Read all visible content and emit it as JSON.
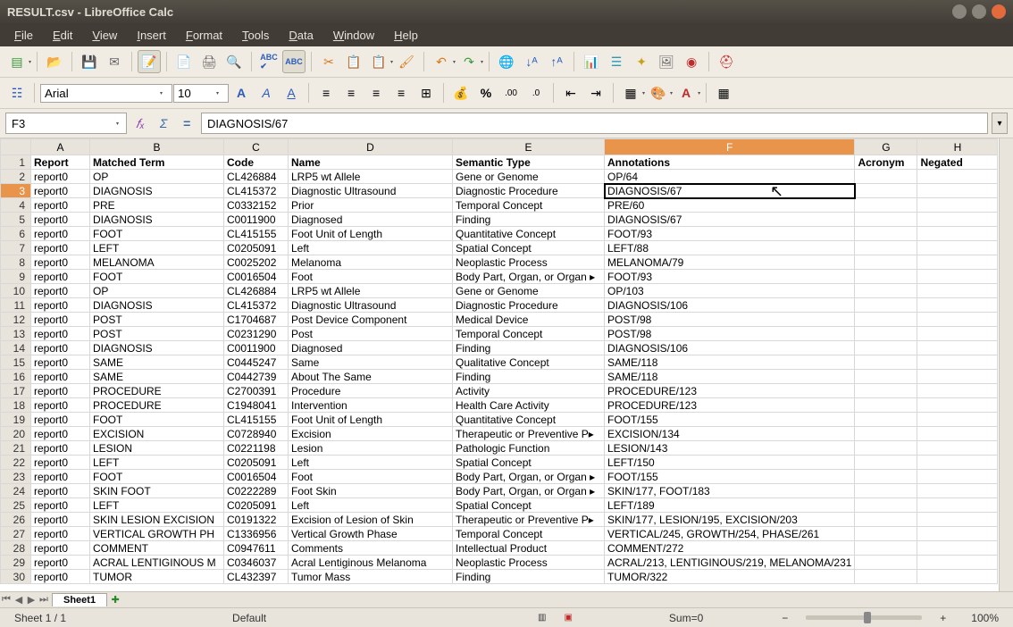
{
  "window": {
    "title": "RESULT.csv - LibreOffice Calc"
  },
  "menu": {
    "items": [
      "File",
      "Edit",
      "View",
      "Insert",
      "Format",
      "Tools",
      "Data",
      "Window",
      "Help"
    ]
  },
  "toolbar2": {
    "font_name": "Arial",
    "font_size": "10"
  },
  "formula": {
    "cell_ref": "F3",
    "content": "DIAGNOSIS/67"
  },
  "columns": [
    "A",
    "B",
    "C",
    "D",
    "E",
    "F",
    "G",
    "H"
  ],
  "selected_col": "F",
  "selected_row": 3,
  "active_cell": "F3",
  "rows": [
    {
      "n": 1,
      "A": "Report",
      "B": "Matched Term",
      "C": "Code",
      "D": "Name",
      "E": "Semantic Type",
      "F": "Annotations",
      "G": "Acronym",
      "H": "Negated"
    },
    {
      "n": 2,
      "A": "report0",
      "B": "OP",
      "C": "CL426884",
      "D": "LRP5 wt Allele",
      "E": "Gene or Genome",
      "F": "OP/64",
      "G": "",
      "H": ""
    },
    {
      "n": 3,
      "A": "report0",
      "B": "DIAGNOSIS",
      "C": "CL415372",
      "D": "Diagnostic Ultrasound",
      "E": "Diagnostic Procedure",
      "F": "DIAGNOSIS/67",
      "G": "",
      "H": ""
    },
    {
      "n": 4,
      "A": "report0",
      "B": "PRE",
      "C": "C0332152",
      "D": "Prior",
      "E": "Temporal Concept",
      "F": "PRE/60",
      "G": "",
      "H": ""
    },
    {
      "n": 5,
      "A": "report0",
      "B": "DIAGNOSIS",
      "C": "C0011900",
      "D": "Diagnosed",
      "E": "Finding",
      "F": "DIAGNOSIS/67",
      "G": "",
      "H": ""
    },
    {
      "n": 6,
      "A": "report0",
      "B": "FOOT",
      "C": "CL415155",
      "D": "Foot Unit of Length",
      "E": "Quantitative Concept",
      "F": "FOOT/93",
      "G": "",
      "H": ""
    },
    {
      "n": 7,
      "A": "report0",
      "B": "LEFT",
      "C": "C0205091",
      "D": "Left",
      "E": "Spatial Concept",
      "F": "LEFT/88",
      "G": "",
      "H": ""
    },
    {
      "n": 8,
      "A": "report0",
      "B": "MELANOMA",
      "C": "C0025202",
      "D": "Melanoma",
      "E": "Neoplastic Process",
      "F": "MELANOMA/79",
      "G": "",
      "H": ""
    },
    {
      "n": 9,
      "A": "report0",
      "B": "FOOT",
      "C": "C0016504",
      "D": "Foot",
      "E": "Body Part, Organ, or Organ ▸",
      "F": "FOOT/93",
      "G": "",
      "H": ""
    },
    {
      "n": 10,
      "A": "report0",
      "B": "OP",
      "C": "CL426884",
      "D": "LRP5 wt Allele",
      "E": "Gene or Genome",
      "F": "OP/103",
      "G": "",
      "H": ""
    },
    {
      "n": 11,
      "A": "report0",
      "B": "DIAGNOSIS",
      "C": "CL415372",
      "D": "Diagnostic Ultrasound",
      "E": "Diagnostic Procedure",
      "F": "DIAGNOSIS/106",
      "G": "",
      "H": ""
    },
    {
      "n": 12,
      "A": "report0",
      "B": "POST",
      "C": "C1704687",
      "D": "Post Device Component",
      "E": "Medical Device",
      "F": "POST/98",
      "G": "",
      "H": ""
    },
    {
      "n": 13,
      "A": "report0",
      "B": "POST",
      "C": "C0231290",
      "D": "Post",
      "E": "Temporal Concept",
      "F": "POST/98",
      "G": "",
      "H": ""
    },
    {
      "n": 14,
      "A": "report0",
      "B": "DIAGNOSIS",
      "C": "C0011900",
      "D": "Diagnosed",
      "E": "Finding",
      "F": "DIAGNOSIS/106",
      "G": "",
      "H": ""
    },
    {
      "n": 15,
      "A": "report0",
      "B": "SAME",
      "C": "C0445247",
      "D": "Same",
      "E": "Qualitative Concept",
      "F": "SAME/118",
      "G": "",
      "H": ""
    },
    {
      "n": 16,
      "A": "report0",
      "B": "SAME",
      "C": "C0442739",
      "D": "About The Same",
      "E": "Finding",
      "F": "SAME/118",
      "G": "",
      "H": ""
    },
    {
      "n": 17,
      "A": "report0",
      "B": "PROCEDURE",
      "C": "C2700391",
      "D": "Procedure",
      "E": "Activity",
      "F": "PROCEDURE/123",
      "G": "",
      "H": ""
    },
    {
      "n": 18,
      "A": "report0",
      "B": "PROCEDURE",
      "C": "C1948041",
      "D": "Intervention",
      "E": "Health Care Activity",
      "F": "PROCEDURE/123",
      "G": "",
      "H": ""
    },
    {
      "n": 19,
      "A": "report0",
      "B": "FOOT",
      "C": "CL415155",
      "D": "Foot Unit of Length",
      "E": "Quantitative Concept",
      "F": "FOOT/155",
      "G": "",
      "H": ""
    },
    {
      "n": 20,
      "A": "report0",
      "B": "EXCISION",
      "C": "C0728940",
      "D": "Excision",
      "E": "Therapeutic or Preventive P▸",
      "F": "EXCISION/134",
      "G": "",
      "H": ""
    },
    {
      "n": 21,
      "A": "report0",
      "B": "LESION",
      "C": "C0221198",
      "D": "Lesion",
      "E": "Pathologic Function",
      "F": "LESION/143",
      "G": "",
      "H": ""
    },
    {
      "n": 22,
      "A": "report0",
      "B": "LEFT",
      "C": "C0205091",
      "D": "Left",
      "E": "Spatial Concept",
      "F": "LEFT/150",
      "G": "",
      "H": ""
    },
    {
      "n": 23,
      "A": "report0",
      "B": "FOOT",
      "C": "C0016504",
      "D": "Foot",
      "E": "Body Part, Organ, or Organ ▸",
      "F": "FOOT/155",
      "G": "",
      "H": ""
    },
    {
      "n": 24,
      "A": "report0",
      "B": "SKIN FOOT",
      "C": "C0222289",
      "D": "Foot Skin",
      "E": "Body Part, Organ, or Organ ▸",
      "F": "SKIN/177, FOOT/183",
      "G": "",
      "H": ""
    },
    {
      "n": 25,
      "A": "report0",
      "B": "LEFT",
      "C": "C0205091",
      "D": "Left",
      "E": "Spatial Concept",
      "F": "LEFT/189",
      "G": "",
      "H": ""
    },
    {
      "n": 26,
      "A": "report0",
      "B": "SKIN LESION EXCISION",
      "C": "C0191322",
      "D": "Excision of Lesion of Skin",
      "E": "Therapeutic or Preventive P▸",
      "F": "SKIN/177, LESION/195, EXCISION/203",
      "G": "",
      "H": ""
    },
    {
      "n": 27,
      "A": "report0",
      "B": "VERTICAL GROWTH PH",
      "C": "C1336956",
      "D": "Vertical Growth Phase",
      "E": "Temporal Concept",
      "F": "VERTICAL/245, GROWTH/254, PHASE/261",
      "G": "",
      "H": ""
    },
    {
      "n": 28,
      "A": "report0",
      "B": "COMMENT",
      "C": "C0947611",
      "D": "Comments",
      "E": "Intellectual Product",
      "F": "COMMENT/272",
      "G": "",
      "H": ""
    },
    {
      "n": 29,
      "A": "report0",
      "B": "ACRAL LENTIGINOUS M",
      "C": "C0346037",
      "D": "Acral Lentiginous Melanoma",
      "E": "Neoplastic Process",
      "F": "ACRAL/213, LENTIGINOUS/219, MELANOMA/231",
      "G": "",
      "H": ""
    },
    {
      "n": 30,
      "A": "report0",
      "B": "TUMOR",
      "C": "CL432397",
      "D": "Tumor Mass",
      "E": "Finding",
      "F": "TUMOR/322",
      "G": "",
      "H": ""
    }
  ],
  "sheet_tab": "Sheet1",
  "status": {
    "sheet": "Sheet 1 / 1",
    "style": "Default",
    "sum": "Sum=0",
    "zoom": "100%"
  }
}
